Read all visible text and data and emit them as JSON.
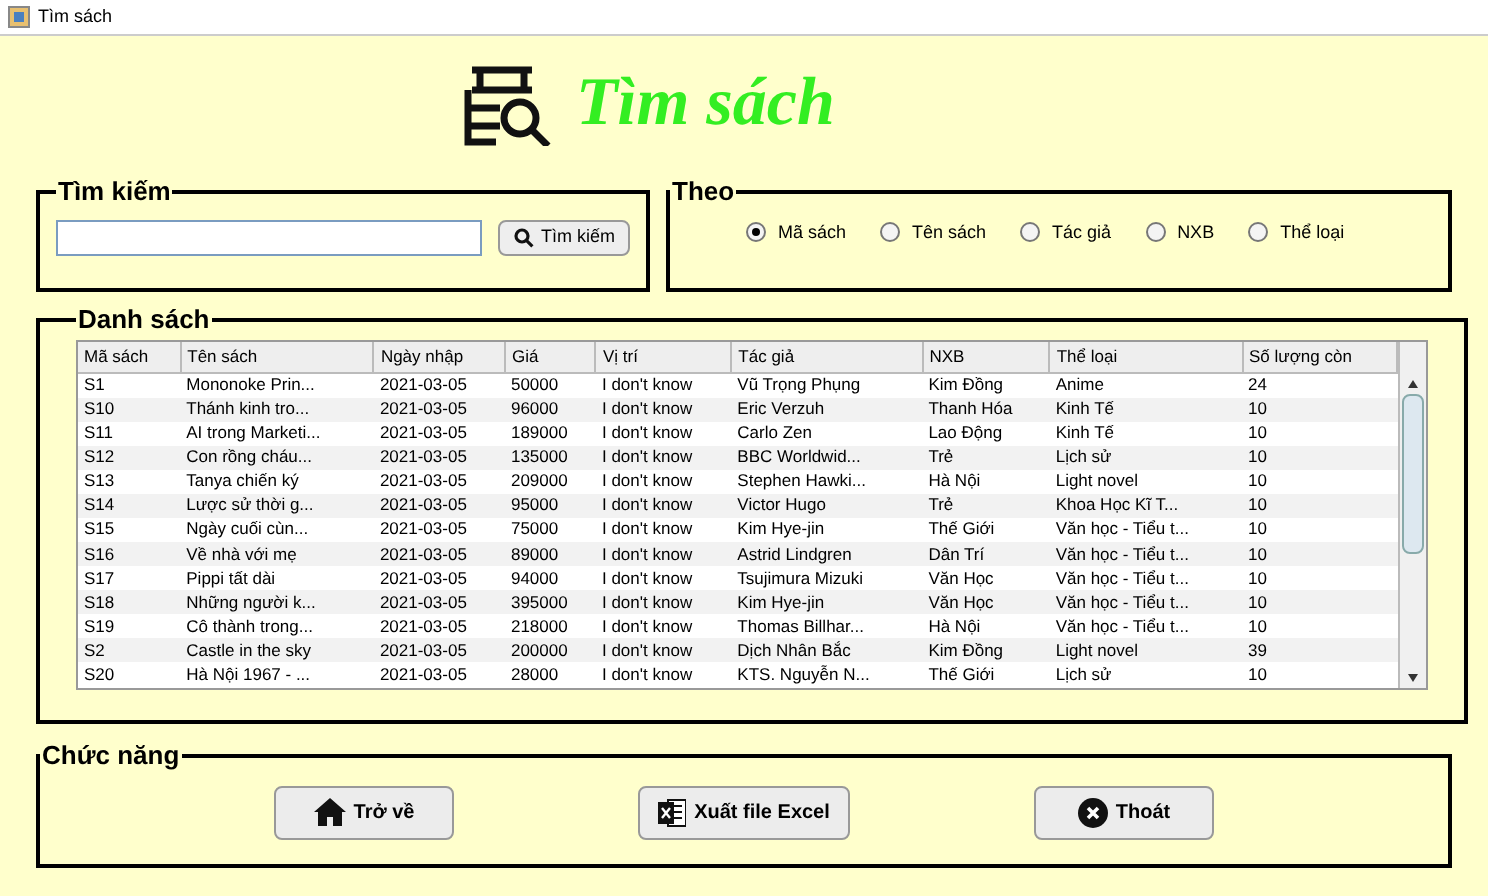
{
  "window": {
    "title": "Tìm sách"
  },
  "heading": "Tìm sách",
  "search": {
    "title": "Tìm kiếm",
    "button": "Tìm kiếm"
  },
  "filter": {
    "title": "Theo",
    "options": [
      {
        "label": "Mã sách",
        "selected": true
      },
      {
        "label": "Tên sách",
        "selected": false
      },
      {
        "label": "Tác giả",
        "selected": false
      },
      {
        "label": "NXB",
        "selected": false
      },
      {
        "label": "Thể loại",
        "selected": false
      }
    ]
  },
  "list": {
    "title": "Danh sách",
    "columns": [
      "Mã sách",
      "Tên sách",
      "Ngày nhập",
      "Giá",
      "Vị trí",
      "Tác giả",
      "NXB",
      "Thể loại",
      "Số lượng còn"
    ],
    "rows": [
      [
        "S1",
        "Mononoke Prin...",
        "2021-03-05",
        "50000",
        "I don't know",
        "Vũ Trọng Phụng",
        "Kim Đồng",
        "Anime",
        "24"
      ],
      [
        "S10",
        "Thánh kinh tro...",
        "2021-03-05",
        "96000",
        "I don't know",
        "Eric Verzuh",
        "Thanh Hóa",
        "Kinh Tế",
        "10"
      ],
      [
        "S11",
        "AI trong Marketi...",
        "2021-03-05",
        "189000",
        "I don't know",
        "Carlo Zen",
        "Lao Động",
        "Kinh Tế",
        "10"
      ],
      [
        "S12",
        "Con rồng cháu...",
        "2021-03-05",
        "135000",
        "I don't know",
        "BBC Worldwid...",
        "Trẻ",
        "Lịch sử",
        "10"
      ],
      [
        "S13",
        "Tanya chiến ký",
        "2021-03-05",
        "209000",
        "I don't know",
        "Stephen Hawki...",
        "Hà Nội",
        "Light novel",
        "10"
      ],
      [
        "S14",
        "Lược sử thời g...",
        "2021-03-05",
        "95000",
        "I don't know",
        "Victor Hugo",
        "Trẻ",
        "Khoa Học Kĩ T...",
        "10"
      ],
      [
        "S15",
        "Ngày cuối cùn...",
        "2021-03-05",
        "75000",
        "I don't know",
        "Kim Hye-jin",
        "Thế Giới",
        "Văn học - Tiểu t...",
        "10"
      ],
      [
        "S16",
        "Về nhà với mẹ",
        "2021-03-05",
        "89000",
        "I don't know",
        "Astrid Lindgren",
        "Dân Trí",
        "Văn học - Tiểu t...",
        "10"
      ],
      [
        "S17",
        "Pippi tất dài",
        "2021-03-05",
        "94000",
        "I don't know",
        "Tsujimura Mizuki",
        "Văn Học",
        "Văn học - Tiểu t...",
        "10"
      ],
      [
        "S18",
        "Những người k...",
        "2021-03-05",
        "395000",
        "I don't know",
        "Kim Hye-jin",
        "Văn Học",
        "Văn học - Tiểu t...",
        "10"
      ],
      [
        "S19",
        "Cô thành trong...",
        "2021-03-05",
        "218000",
        "I don't know",
        "Thomas Billhar...",
        "Hà Nội",
        "Văn học - Tiểu t...",
        "10"
      ],
      [
        "S2",
        "Castle in the sky",
        "2021-03-05",
        "200000",
        "I don't know",
        "Dịch Nhân Bắc",
        "Kim Đồng",
        "Light novel",
        "39"
      ],
      [
        "S20",
        "Hà Nội 1967 - ...",
        "2021-03-05",
        "28000",
        "I don't know",
        "KTS. Nguyễn N...",
        "Thế Giới",
        "Lịch sử",
        "10"
      ]
    ]
  },
  "actions": {
    "title": "Chức năng",
    "buttons": [
      {
        "kind": "home",
        "label": "Trở về"
      },
      {
        "kind": "excel",
        "label": "Xuất file Excel"
      },
      {
        "kind": "exit",
        "label": "Thoát"
      }
    ]
  }
}
